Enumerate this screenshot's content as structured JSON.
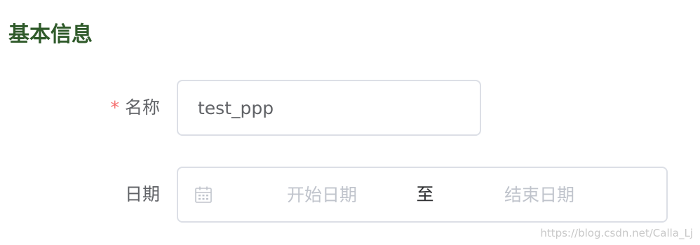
{
  "section": {
    "title": "基本信息"
  },
  "form": {
    "name": {
      "required_mark": "*",
      "label": "名称",
      "value": "test_ppp"
    },
    "date": {
      "label": "日期",
      "start_placeholder": "开始日期",
      "separator": "至",
      "end_placeholder": "结束日期",
      "icon": "calendar-icon"
    }
  },
  "watermark": {
    "text": "https://blog.csdn.net/Calla_Lj"
  },
  "colors": {
    "title": "#2f5a2a",
    "label": "#606266",
    "required": "#f56c6c",
    "border": "#dcdfe6",
    "placeholder": "#c0c4cc"
  }
}
